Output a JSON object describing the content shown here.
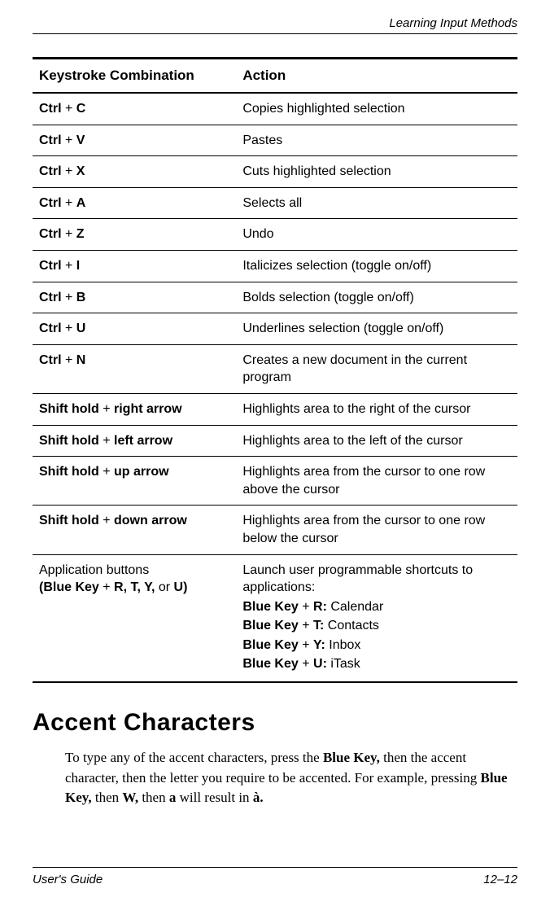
{
  "header": {
    "running_title": "Learning Input Methods"
  },
  "table": {
    "head": {
      "col1": "Keystroke Combination",
      "col2": "Action"
    },
    "rows": [
      {
        "k_pre": "Ctrl",
        "k_plus": " + ",
        "k_post": "C",
        "action": "Copies highlighted selection"
      },
      {
        "k_pre": "Ctrl",
        "k_plus": " + ",
        "k_post": "V",
        "action": "Pastes"
      },
      {
        "k_pre": "Ctrl",
        "k_plus": " + ",
        "k_post": "X",
        "action": "Cuts highlighted selection"
      },
      {
        "k_pre": "Ctrl",
        "k_plus": " + ",
        "k_post": "A",
        "action": "Selects all"
      },
      {
        "k_pre": "Ctrl",
        "k_plus": " + ",
        "k_post": "Z",
        "action": "Undo"
      },
      {
        "k_pre": "Ctrl",
        "k_plus": " + ",
        "k_post": "I",
        "action": "Italicizes selection (toggle on/off)"
      },
      {
        "k_pre": "Ctrl",
        "k_plus": " + ",
        "k_post": "B",
        "action": "Bolds selection (toggle on/off)"
      },
      {
        "k_pre": "Ctrl",
        "k_plus": " + ",
        "k_post": "U",
        "action": "Underlines selection (toggle on/off)"
      },
      {
        "k_pre": "Ctrl",
        "k_plus": " + ",
        "k_post": "N",
        "action": "Creates a new document in the current program"
      },
      {
        "k_pre": "Shift hold",
        "k_plus": " + ",
        "k_post": "right arrow",
        "action": "Highlights area to the right of the cursor"
      },
      {
        "k_pre": "Shift hold",
        "k_plus": " + ",
        "k_post": "left arrow",
        "action": "Highlights area to the left of the cursor"
      },
      {
        "k_pre": "Shift hold",
        "k_plus": " + ",
        "k_post": "up arrow",
        "action": "Highlights area from the cursor to one row above the cursor"
      },
      {
        "k_pre": "Shift hold",
        "k_plus": " + ",
        "k_post": "down arrow",
        "action": "Highlights area from the cursor to one row below the cursor"
      }
    ],
    "app_row": {
      "col1_line1": "Application buttons",
      "col1_line2_pre": "(Blue Key",
      "col1_line2_plus": " + ",
      "col1_line2_post": "R, T, Y,",
      "col1_line2_or": " or ",
      "col1_line2_end": "U)",
      "intro": "Launch user programmable shortcuts to applications:",
      "items": [
        {
          "key": "Blue Key",
          "plus": " + ",
          "letter": "R:",
          "app": " Calendar"
        },
        {
          "key": "Blue Key",
          "plus": " + ",
          "letter": "T:",
          "app": " Contacts"
        },
        {
          "key": "Blue Key",
          "plus": " + ",
          "letter": "Y:",
          "app": " Inbox"
        },
        {
          "key": "Blue Key",
          "plus": " + ",
          "letter": "U:",
          "app": " iTask"
        }
      ]
    }
  },
  "section": {
    "heading": "Accent Characters",
    "p1": "To type any of the accent characters, press the ",
    "p1_b1": "Blue Key,",
    "p2": " then the accent character, then the letter you require to be accented. For example, pressing ",
    "p2_b1": "Blue Key,",
    "p3": " then ",
    "p3_b1": "W,",
    "p4": " then ",
    "p4_b1": "a",
    "p5": " will result in ",
    "p5_b1": "à."
  },
  "footer": {
    "left": "User's Guide",
    "right": "12–12"
  }
}
